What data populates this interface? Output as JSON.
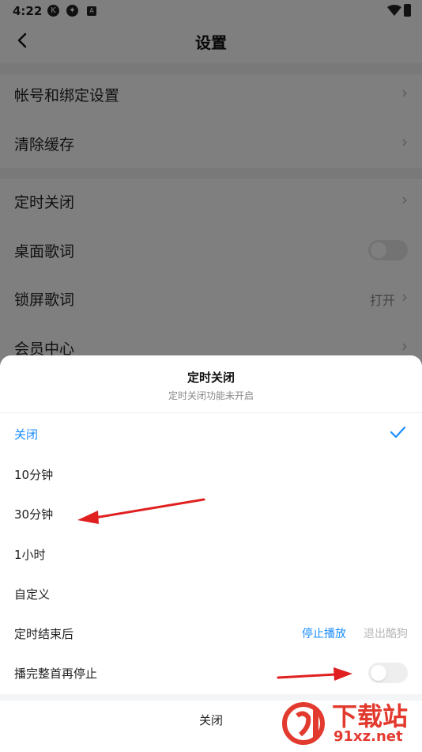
{
  "status_bar": {
    "time": "4:22",
    "icons": [
      "k-icon",
      "pinwheel-icon",
      "a-icon",
      "wifi-icon",
      "battery-icon"
    ]
  },
  "header": {
    "title": "设置"
  },
  "settings": {
    "items": [
      {
        "label": "帐号和绑定设置"
      },
      {
        "label": "清除缓存"
      },
      {
        "label": "定时关闭"
      },
      {
        "label": "桌面歌词"
      },
      {
        "label": "锁屏歌词",
        "value": "打开"
      },
      {
        "label": "会员中心"
      }
    ]
  },
  "sheet": {
    "title": "定时关闭",
    "subtitle": "定时关闭功能未开启",
    "options": [
      {
        "label": "关闭",
        "selected": true
      },
      {
        "label": "10分钟"
      },
      {
        "label": "30分钟"
      },
      {
        "label": "1小时"
      },
      {
        "label": "自定义"
      }
    ],
    "after_end": {
      "label": "定时结束后",
      "stop_label": "停止播放",
      "exit_label": "退出酷狗"
    },
    "finish_song": {
      "label": "播完整首再停止",
      "enabled": false
    },
    "close_label": "关闭"
  },
  "watermark": {
    "text_top": "下载站",
    "text_bottom": "91xz.net"
  },
  "colors": {
    "accent": "#1a8cff",
    "arrow": "#e02020",
    "watermark": "#e23a2e"
  }
}
